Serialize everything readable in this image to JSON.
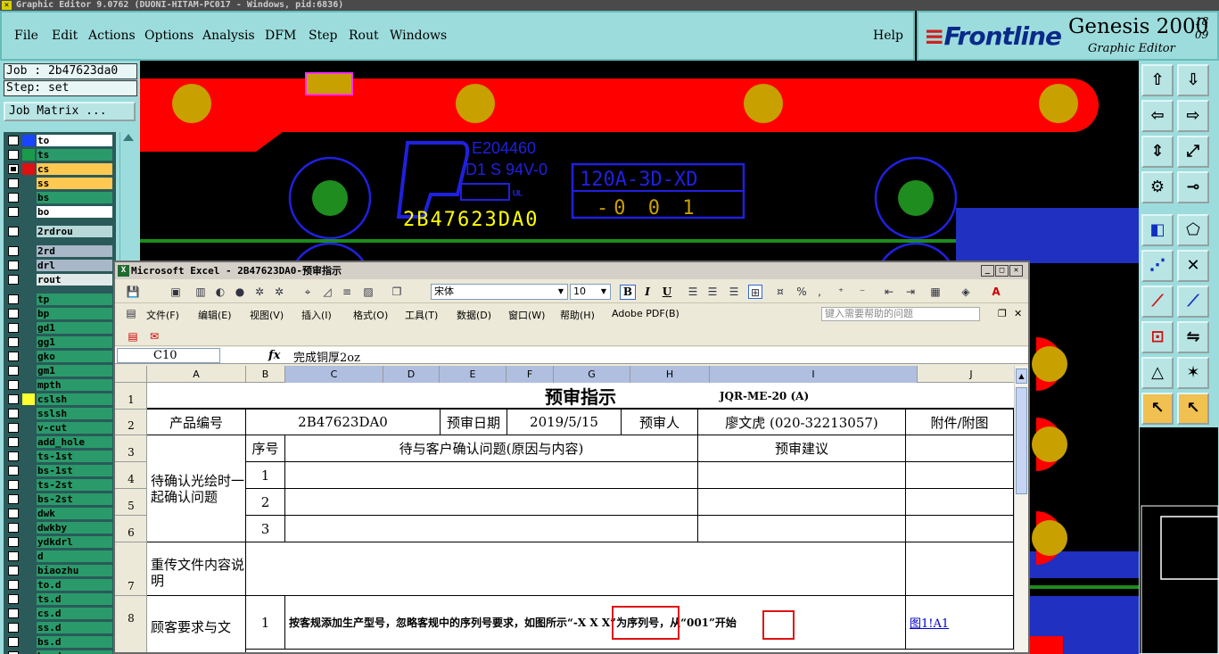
{
  "genesis": {
    "title": "Graphic Editor 9.0762 (DUONI-HITAM-PC017 - Windows, pid:6836)",
    "menu": [
      "File",
      "Edit",
      "Actions",
      "Options",
      "Analysis",
      "DFM",
      "Step",
      "Rout",
      "Windows"
    ],
    "help": "Help",
    "brand": {
      "logo": "Frontline",
      "product": "Genesis 2000",
      "subtitle": "Graphic Editor",
      "clock_line1": "18",
      "clock_line2": "09"
    },
    "job_label": "Job : 2b47623da0",
    "step_label": "Step: set",
    "job_matrix_button": "Job Matrix ...",
    "colors": {
      "panel": "#9ddcdc",
      "copper_red": "#ff0000",
      "pad": "#c8a000",
      "drill": "#1e8c1e",
      "silk_blue": "#2020e0",
      "marker": "#ffff00"
    }
  },
  "layers": [
    {
      "name": "to",
      "checked": false,
      "swatch": "#1a44ff",
      "color": "#ffffff"
    },
    {
      "name": "ts",
      "checked": false,
      "swatch": "#1a9a4a",
      "color": "#2a9a6a"
    },
    {
      "name": "cs",
      "checked": true,
      "swatch": "#e01010",
      "color": "#ffc850"
    },
    {
      "name": "ss",
      "checked": false,
      "swatch": "",
      "color": "#ffc850"
    },
    {
      "name": "bs",
      "checked": false,
      "swatch": "",
      "color": "#2a9a6a"
    },
    {
      "name": "bo",
      "checked": false,
      "swatch": "",
      "color": "#ffffff"
    },
    {
      "name": "2rdrou",
      "checked": false,
      "swatch": "",
      "color": "#b8d8d8"
    },
    {
      "name": "2rd",
      "checked": false,
      "swatch": "",
      "color": "#a8b8c8"
    },
    {
      "name": "drl",
      "checked": false,
      "swatch": "",
      "color": "#a8b8c8"
    },
    {
      "name": "rout",
      "checked": false,
      "swatch": "",
      "color": "#e0e8e8"
    },
    {
      "name": "tp",
      "checked": false,
      "swatch": "",
      "color": "#2a9a6a"
    },
    {
      "name": "bp",
      "checked": false,
      "swatch": "",
      "color": "#2a9a6a"
    },
    {
      "name": "gd1",
      "checked": false,
      "swatch": "",
      "color": "#2a9a6a"
    },
    {
      "name": "gg1",
      "checked": false,
      "swatch": "",
      "color": "#2a9a6a"
    },
    {
      "name": "gko",
      "checked": false,
      "swatch": "",
      "color": "#2a9a6a"
    },
    {
      "name": "gm1",
      "checked": false,
      "swatch": "",
      "color": "#2a9a6a"
    },
    {
      "name": "mpth",
      "checked": false,
      "swatch": "",
      "color": "#2a9a6a"
    },
    {
      "name": "cslsh",
      "checked": false,
      "swatch": "#ffff30",
      "color": "#2a9a6a"
    },
    {
      "name": "sslsh",
      "checked": false,
      "swatch": "",
      "color": "#2a9a6a"
    },
    {
      "name": "v-cut",
      "checked": false,
      "swatch": "",
      "color": "#2a9a6a"
    },
    {
      "name": "add_hole",
      "checked": false,
      "swatch": "",
      "color": "#2a9a6a"
    },
    {
      "name": "ts-1st",
      "checked": false,
      "swatch": "",
      "color": "#2a9a6a"
    },
    {
      "name": "bs-1st",
      "checked": false,
      "swatch": "",
      "color": "#2a9a6a"
    },
    {
      "name": "ts-2st",
      "checked": false,
      "swatch": "",
      "color": "#2a9a6a"
    },
    {
      "name": "bs-2st",
      "checked": false,
      "swatch": "",
      "color": "#2a9a6a"
    },
    {
      "name": "dwk",
      "checked": false,
      "swatch": "",
      "color": "#2a9a6a"
    },
    {
      "name": "dwkby",
      "checked": false,
      "swatch": "",
      "color": "#2a9a6a"
    },
    {
      "name": "ydkdrl",
      "checked": false,
      "swatch": "",
      "color": "#2a9a6a"
    },
    {
      "name": "d",
      "checked": false,
      "swatch": "",
      "color": "#2a9a6a"
    },
    {
      "name": "biaozhu",
      "checked": false,
      "swatch": "",
      "color": "#2a9a6a"
    },
    {
      "name": "to.d",
      "checked": false,
      "swatch": "",
      "color": "#2a9a6a"
    },
    {
      "name": "ts.d",
      "checked": false,
      "swatch": "",
      "color": "#2a9a6a"
    },
    {
      "name": "cs.d",
      "checked": false,
      "swatch": "",
      "color": "#2a9a6a"
    },
    {
      "name": "ss.d",
      "checked": false,
      "swatch": "",
      "color": "#2a9a6a"
    },
    {
      "name": "bs.d",
      "checked": false,
      "swatch": "",
      "color": "#2a9a6a"
    },
    {
      "name": "bo.d",
      "checked": false,
      "swatch": "",
      "color": "#2a9a6a"
    }
  ],
  "pcb": {
    "ul_text": "E204460",
    "rating_text": "D1 S 94V-0",
    "part_number": "2B47623DA0",
    "box_line1": "120A-3D-XD",
    "box_line2": "-0 0 1"
  },
  "tools": [
    "box-up-arrow-icon",
    "box-down-arrow-icon",
    "box-left-arrow-icon",
    "box-right-arrow-icon",
    "fit-vertical-icon",
    "fit-all-icon",
    "settings-tools-icon",
    "measure-icon",
    "select-pad-icon",
    "edit-shape-icon",
    "net-icon",
    "cross-icon",
    "line-red-icon",
    "line-blue-icon",
    "snap-icon",
    "flip-icon",
    "triangle-icon",
    "triangle-star-icon",
    "pointer-icon",
    "pointer-box-icon"
  ],
  "excel": {
    "title": "Microsoft Excel - 2B47623DA0-预审指示",
    "font_name": "宋体",
    "font_size": "10",
    "menu": [
      "文件(F)",
      "编辑(E)",
      "视图(V)",
      "插入(I)",
      "格式(O)",
      "工具(T)",
      "数据(D)",
      "窗口(W)",
      "帮助(H)",
      "Adobe PDF(B)"
    ],
    "help_placeholder": "键入需要帮助的问题",
    "name_box": "C10",
    "fx": "fx",
    "formula": "完成铜厚2oz",
    "columns": [
      "A",
      "B",
      "C",
      "D",
      "E",
      "F",
      "G",
      "H",
      "I",
      "J"
    ],
    "rows": [
      "1",
      "2",
      "3",
      "4",
      "5",
      "6",
      "7",
      "8"
    ],
    "sheet": {
      "title": "预审指示",
      "doc_code": "JQR-ME-20 (A)",
      "r2": {
        "product_no_label": "产品编号",
        "product_no": "2B47623DA0",
        "date_label": "预审日期",
        "date": "2019/5/15",
        "reviewer_label": "预审人",
        "reviewer": "廖文虎 (020-32213057)",
        "attach_label": "附件/附图"
      },
      "r3": {
        "seq_label": "序号",
        "issue_label": "待与客户确认问题(原因与内容)",
        "advice_label": "预审建议"
      },
      "group_confirm": "待确认光绘时一起确认问题",
      "seq": [
        "1",
        "2",
        "3"
      ],
      "resend_label": "重传文件内容说明",
      "customer_label": "顾客要求与文",
      "r8_seq": "1",
      "r8_text": "按客规添加生产型号，忽略客规中的序列号要求，如图所示“-X X X”为序列号，从“001”开始",
      "r8_link": "图1!A1"
    }
  }
}
